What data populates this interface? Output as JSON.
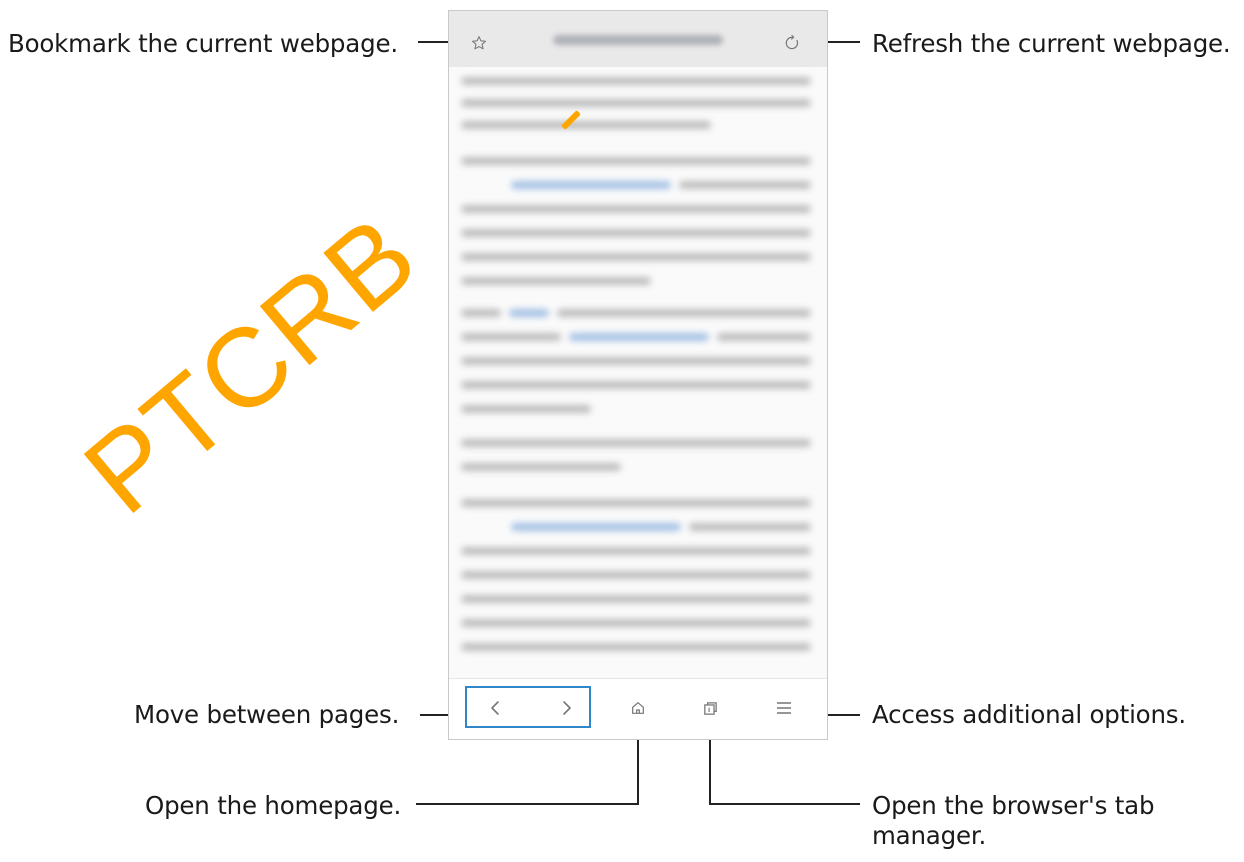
{
  "callouts": {
    "bookmark": "Bookmark the current webpage.",
    "refresh": "Refresh the current webpage.",
    "move_pages": "Move between pages.",
    "more_options": "Access additional options.",
    "homepage": "Open the homepage.",
    "tab_manager_line1": "Open the browser's tab",
    "tab_manager_line2": "manager."
  },
  "icons": {
    "bookmark": "star-icon",
    "refresh": "refresh-icon",
    "back": "chevron-left-icon",
    "forward": "chevron-right-icon",
    "home": "home-icon",
    "tabs": "tabs-icon",
    "menu": "menu-icon"
  },
  "watermark": "PTCRB",
  "colors": {
    "nav_highlight": "#2f86c8",
    "watermark": "#ffa500",
    "link_blur": "#9bbbe3"
  }
}
